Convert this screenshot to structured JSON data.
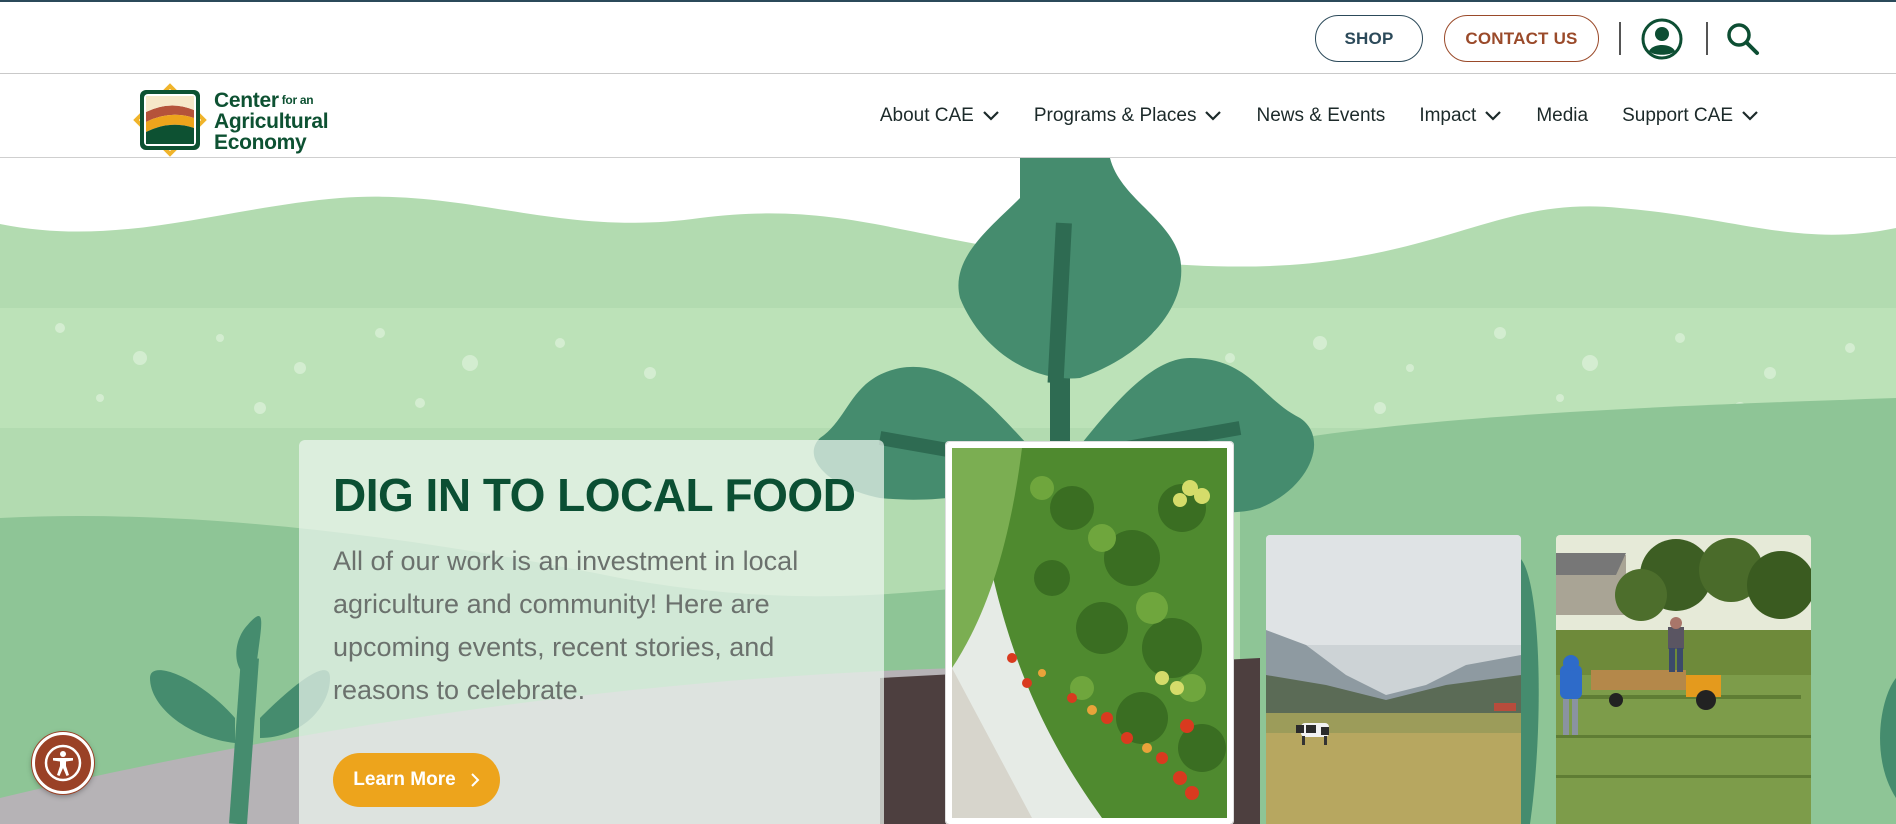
{
  "utility": {
    "shop_label": "SHOP",
    "contact_label": "CONTACT US",
    "account_icon": "account-icon",
    "search_icon": "search-icon"
  },
  "logo": {
    "line1": "Center",
    "line1_small": "for an",
    "line2": "Agricultural",
    "line3": "Economy"
  },
  "nav": {
    "items": [
      {
        "label": "About CAE",
        "has_dropdown": true
      },
      {
        "label": "Programs & Places",
        "has_dropdown": true
      },
      {
        "label": "News & Events",
        "has_dropdown": false
      },
      {
        "label": "Impact",
        "has_dropdown": true
      },
      {
        "label": "Media",
        "has_dropdown": false
      },
      {
        "label": "Support CAE",
        "has_dropdown": true
      }
    ]
  },
  "hero": {
    "title": "DIG IN TO LOCAL FOOD",
    "body": "All of our work is an investment in local agriculture and community! Here are upcoming events, recent stories, and reasons to celebrate.",
    "cta_label": "Learn More"
  },
  "colors": {
    "brand_green": "#0b4f33",
    "cta_orange": "#eda41c",
    "contact_brown": "#9a4a2a",
    "shop_blue": "#2c4a5a",
    "hill_light": "#b2dbb0",
    "hill_mid": "#8ec596",
    "plant_green": "#458c6e"
  }
}
